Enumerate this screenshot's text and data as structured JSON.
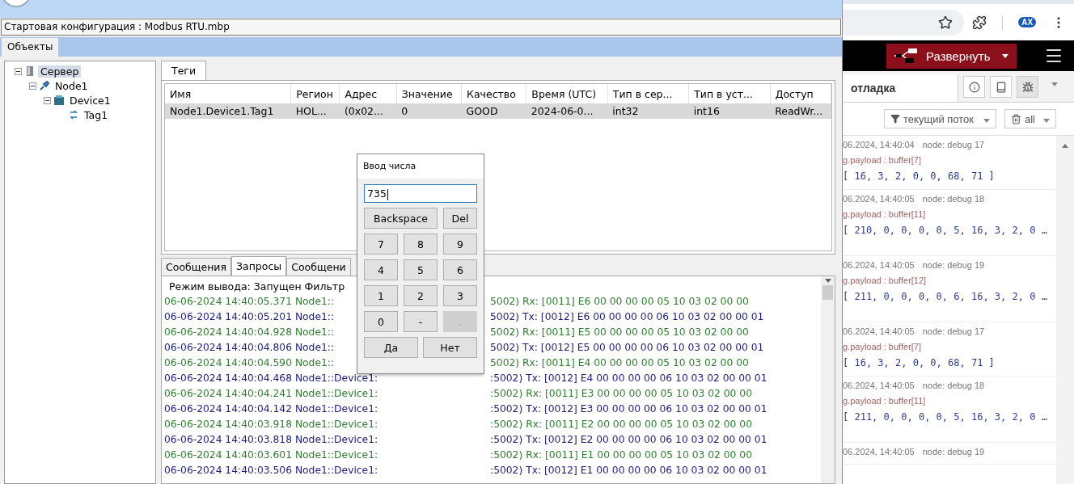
{
  "config_path": "Стартовая конфигурация : Modbus RTU.mbp",
  "object_tabs": [
    {
      "label": "Объекты",
      "selected": true
    }
  ],
  "tree": [
    {
      "label": "Сервер",
      "kind": "server",
      "selected": true,
      "expanded": true,
      "children": [
        {
          "label": "Node1",
          "kind": "node",
          "selected": false,
          "expanded": true,
          "children": [
            {
              "label": "Device1",
              "kind": "device",
              "selected": false,
              "expanded": true,
              "children": [
                {
                  "label": "Tag1",
                  "kind": "tag",
                  "selected": false
                }
              ]
            }
          ]
        }
      ]
    }
  ],
  "tag_tabs": [
    {
      "label": "Теги",
      "selected": true
    }
  ],
  "tags_table": {
    "columns": [
      "Имя",
      "Регион",
      "Адрес",
      "Значение",
      "Качество",
      "Время (UTC)",
      "Тип в сер...",
      "Тип в уст...",
      "Доступ"
    ],
    "rows": [
      {
        "selected": true,
        "cells": [
          "Node1.Device1.Tag1",
          "HOL...",
          "(0x02...",
          "0",
          "GOOD",
          "2024-06-0...",
          "int32",
          "int16",
          "ReadWr..."
        ]
      }
    ]
  },
  "log_tabs": [
    {
      "label": "Сообщения",
      "selected": false
    },
    {
      "label": "Запросы",
      "selected": true
    },
    {
      "label": "Сообщени",
      "selected": false
    }
  ],
  "log": {
    "header": "Режим вывода: Запущен Фильтр",
    "lines": [
      {
        "kind": "rx",
        "part_1": "06-06-2024 14:40:05.371 Node1::",
        "part_2": "5002) Rx: [0011] E6 00 00 00 00 05 10 03 02 00 00"
      },
      {
        "kind": "tx",
        "part_1": "06-06-2024 14:40:05.201 Node1::",
        "part_2": "5002) Tx: [0012] E6 00 00 00 00 06 10 03 02 00 00 01"
      },
      {
        "kind": "rx",
        "part_1": "06-06-2024 14:40:04.928 Node1::",
        "part_2": "5002) Rx: [0011] E5 00 00 00 00 05 10 03 02 00 00"
      },
      {
        "kind": "tx",
        "part_1": "06-06-2024 14:40:04.806 Node1::",
        "part_2": "5002) Tx: [0012] E5 00 00 00 00 06 10 03 02 00 00 01"
      },
      {
        "kind": "rx",
        "part_1": "06-06-2024 14:40:04.590 Node1::",
        "part_2": "5002) Rx: [0011] E4 00 00 00 00 05 10 03 02 00 00"
      },
      {
        "kind": "tx",
        "part_1": "06-06-2024 14:40:04.468 Node1::Device1:",
        "part_2": ":5002) Tx: [0012] E4 00 00 00 00 06 10 03 02 00 00 01"
      },
      {
        "kind": "rx",
        "part_1": "06-06-2024 14:40:04.241 Node1::Device1:",
        "part_2": ":5002) Rx: [0011] E3 00 00 00 00 05 10 03 02 00 00"
      },
      {
        "kind": "tx",
        "part_1": "06-06-2024 14:40:04.142 Node1::Device1:",
        "part_2": ":5002) Tx: [0012] E3 00 00 00 00 06 10 03 02 00 00 01"
      },
      {
        "kind": "rx",
        "part_1": "06-06-2024 14:40:03.918 Node1::Device1:",
        "part_2": ":5002) Rx: [0011] E2 00 00 00 00 05 10 03 02 00 00"
      },
      {
        "kind": "tx",
        "part_1": "06-06-2024 14:40:03.818 Node1::Device1:",
        "part_2": ":5002) Tx: [0012] E2 00 00 00 00 06 10 03 02 00 00 01"
      },
      {
        "kind": "rx",
        "part_1": "06-06-2024 14:40:03.601 Node1::Device1:",
        "part_2": ":5002) Rx: [0011] E1 00 00 00 00 05 10 03 02 00 00"
      },
      {
        "kind": "tx",
        "part_1": "06-06-2024 14:40:03.506 Node1::Device1:",
        "part_2": ":5002) Tx: [0012] E1 00 00 00 00 06 10 03 02 00 00 01"
      }
    ]
  },
  "number_dialog": {
    "title": "Ввод числа",
    "value": "735",
    "edit_keys": [
      {
        "label": "Backspace",
        "disabled": false
      },
      {
        "label": "Del",
        "disabled": false
      }
    ],
    "digit_keys": [
      {
        "label": "7",
        "disabled": false
      },
      {
        "label": "8",
        "disabled": false
      },
      {
        "label": "9",
        "disabled": false
      },
      {
        "label": "4",
        "disabled": false
      },
      {
        "label": "5",
        "disabled": false
      },
      {
        "label": "6",
        "disabled": false
      },
      {
        "label": "1",
        "disabled": false
      },
      {
        "label": "2",
        "disabled": false
      },
      {
        "label": "3",
        "disabled": false
      },
      {
        "label": "0",
        "disabled": false
      },
      {
        "label": "-",
        "disabled": false
      },
      {
        "label": ".",
        "disabled": true
      }
    ],
    "buttons": [
      "Да",
      "Нет"
    ]
  },
  "browser": {
    "profile_badge": "AX",
    "deploy_button": "Развернуть",
    "sidebar_tabs": [
      {
        "label": "отладка",
        "selected": true
      }
    ],
    "sidebar_tools": [
      {
        "kind": "info",
        "selected": false
      },
      {
        "kind": "book",
        "selected": false
      },
      {
        "kind": "bug",
        "selected": true
      }
    ],
    "filter_button": "текущий поток",
    "clear_button": "all",
    "messages": [
      {
        "time": "06.2024, 14:40:04",
        "node": "node: debug 17",
        "type": "g.payload : buffer[7]",
        "value": "[ 16, 3, 2, 0, 0, 68, 71 ]"
      },
      {
        "time": "06.2024, 14:40:05",
        "node": "node: debug 18",
        "type": "g.payload : buffer[11]",
        "value": "[ 210, 0, 0, 0, 0, 5, 16, 3, 2, 0 …"
      },
      {
        "time": "06.2024, 14:40:05",
        "node": "node: debug 19",
        "type": "g.payload : buffer[12]",
        "value": "[ 211, 0, 0, 0, 0, 6, 16, 3, 2, 0 …"
      },
      {
        "time": "06.2024, 14:40:05",
        "node": "node: debug 17",
        "type": "g.payload : buffer[7]",
        "value": "[ 16, 3, 2, 0, 0, 68, 71 ]"
      },
      {
        "time": "06.2024, 14:40:05",
        "node": "node: debug 18",
        "type": "g.payload : buffer[11]",
        "value": "[ 211, 0, 0, 0, 0, 5, 16, 3, 2, 0 …"
      },
      {
        "time": "06.2024, 14:40:05",
        "node": "node: debug 19"
      }
    ]
  }
}
